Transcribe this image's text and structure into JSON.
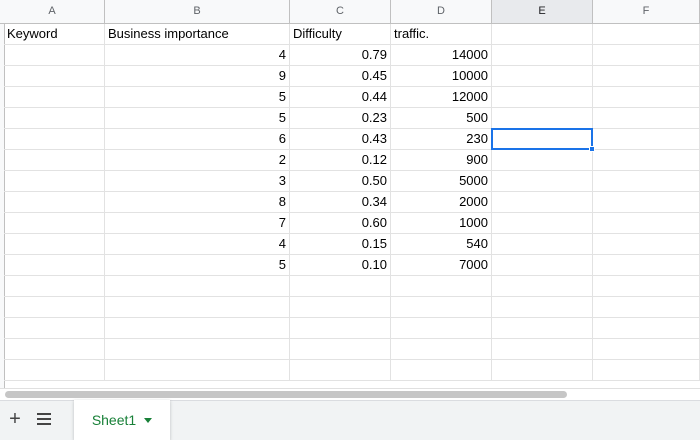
{
  "columns": [
    "A",
    "B",
    "C",
    "D",
    "E",
    "F"
  ],
  "headers": {
    "keyword": "Keyword",
    "business_importance": "Business importance",
    "difficulty": "Difficulty",
    "traffic": "traffic."
  },
  "rows": [
    {
      "importance": "4",
      "difficulty": "0.79",
      "traffic": "14000"
    },
    {
      "importance": "9",
      "difficulty": "0.45",
      "traffic": "10000"
    },
    {
      "importance": "5",
      "difficulty": "0.44",
      "traffic": "12000"
    },
    {
      "importance": "5",
      "difficulty": "0.23",
      "traffic": "500"
    },
    {
      "importance": "6",
      "difficulty": "0.43",
      "traffic": "230"
    },
    {
      "importance": "2",
      "difficulty": "0.12",
      "traffic": "900"
    },
    {
      "importance": "3",
      "difficulty": "0.50",
      "traffic": "5000"
    },
    {
      "importance": "8",
      "difficulty": "0.34",
      "traffic": "2000"
    },
    {
      "importance": "7",
      "difficulty": "0.60",
      "traffic": "1000"
    },
    {
      "importance": "4",
      "difficulty": "0.15",
      "traffic": "540"
    },
    {
      "importance": "5",
      "difficulty": "0.10",
      "traffic": "7000"
    }
  ],
  "sheet_tabs": [
    {
      "label": "Sheet1"
    }
  ],
  "icons": {
    "add": "plus-icon",
    "list": "list-icon",
    "caret": "caret-down-icon"
  },
  "colors": {
    "selection": "#1a73e8",
    "tab_text": "#188038"
  }
}
